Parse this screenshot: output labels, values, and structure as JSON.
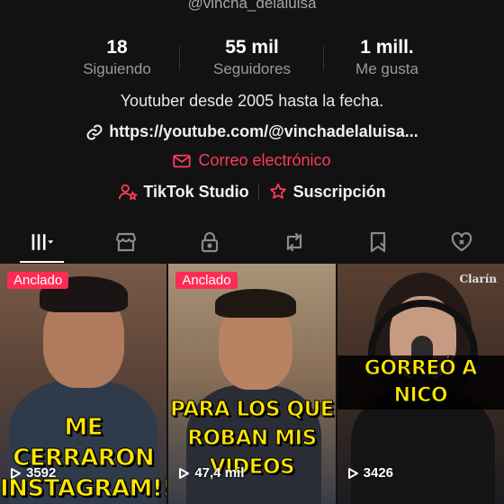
{
  "profile": {
    "handle": "@vincha_delaluisa",
    "stats": [
      {
        "value": "18",
        "label": "Siguiendo"
      },
      {
        "value": "55 mil",
        "label": "Seguidores"
      },
      {
        "value": "1 mill.",
        "label": "Me gusta"
      }
    ],
    "bio": "Youtuber desde 2005 hasta la fecha.",
    "link": "https://youtube.com/@vinchadelaluisa...",
    "email_label": "Correo electrónico",
    "studio_label": "TikTok Studio",
    "subscription_label": "Suscripción"
  },
  "tabs": [
    {
      "icon": "videos-grid-icon",
      "active": true
    },
    {
      "icon": "shop-icon",
      "active": false
    },
    {
      "icon": "lock-icon",
      "active": false
    },
    {
      "icon": "repost-icon",
      "active": false
    },
    {
      "icon": "saved-icon",
      "active": false
    },
    {
      "icon": "liked-icon",
      "active": false
    }
  ],
  "videos": [
    {
      "pinned_label": "Anclado",
      "caption": "ME CERRARON INSTAGRAM!!!",
      "views": "3592"
    },
    {
      "pinned_label": "Anclado",
      "caption": "PARA LOS QUE ROBAN MIS VIDEOS",
      "views": "47,4 mil"
    },
    {
      "pinned_label": "",
      "caption": "GORREÓ A NICO",
      "views": "3426",
      "logo": "Clarín"
    }
  ],
  "colors": {
    "background": "#121212",
    "accent": "#fe2c55",
    "caption_yellow": "#ffe600"
  }
}
